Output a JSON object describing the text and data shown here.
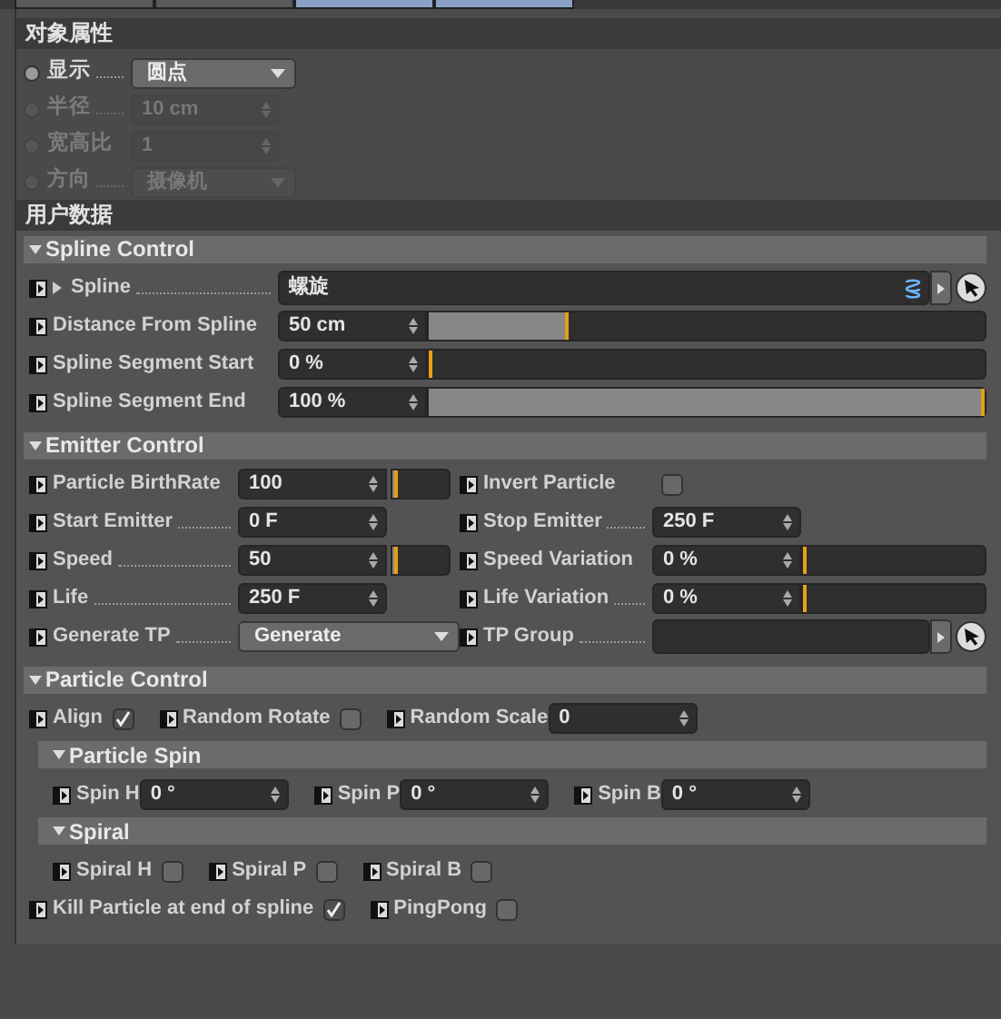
{
  "tabs": [
    {
      "selected": false
    },
    {
      "selected": false
    },
    {
      "selected": true
    },
    {
      "selected": true
    }
  ],
  "object_properties": {
    "title": "对象属性",
    "fields": [
      {
        "label": "显示",
        "leader": true,
        "kind": "dropdown",
        "value": "圆点",
        "disabled": false
      },
      {
        "label": "半径",
        "leader": true,
        "kind": "number",
        "value": "10 cm",
        "disabled": true
      },
      {
        "label": "宽高比",
        "leader": false,
        "kind": "number",
        "value": "1",
        "disabled": true
      },
      {
        "label": "方向",
        "leader": true,
        "kind": "dropdown",
        "value": "摄像机",
        "disabled": true
      }
    ]
  },
  "user_data": {
    "title": "用户数据",
    "groups": [
      {
        "title": "Spline Control",
        "kind": "form",
        "expanded": true,
        "rows": [
          {
            "kind": "row",
            "items": [
              {
                "kind": "link",
                "label": "Spline",
                "leader": true,
                "expandable": true,
                "value": "螺旋"
              }
            ]
          },
          {
            "kind": "row",
            "items": [
              {
                "kind": "slider",
                "label": "Distance From Spline",
                "leader": false,
                "value": "50 cm",
                "level": 0.25
              }
            ]
          },
          {
            "kind": "row",
            "items": [
              {
                "kind": "slider",
                "label": "Spline Segment Start",
                "leader": false,
                "value": "0 %",
                "level": 0
              }
            ]
          },
          {
            "kind": "row",
            "items": [
              {
                "kind": "slider",
                "label": "Spline Segment End",
                "leader": false,
                "value": "100 %",
                "level": 1
              }
            ]
          }
        ]
      },
      {
        "title": "Emitter Control",
        "kind": "grid",
        "expanded": true,
        "rows": [
          {
            "kind": "row",
            "items": [
              {
                "kind": "mini-slider",
                "label": "Particle BirthRate",
                "leader": false,
                "value": "100",
                "level": 0.1
              },
              {
                "kind": "checkbox",
                "label": "Invert Particle",
                "leader": false,
                "checked": false
              }
            ]
          },
          {
            "kind": "row",
            "items": [
              {
                "kind": "number",
                "label": "Start Emitter",
                "leader": true,
                "value": "0 F"
              },
              {
                "kind": "number",
                "label": "Stop Emitter",
                "leader": true,
                "value": "250 F"
              }
            ]
          },
          {
            "kind": "row",
            "items": [
              {
                "kind": "mini-slider",
                "label": "Speed",
                "leader": true,
                "value": "50",
                "level": 0.1
              },
              {
                "kind": "slider",
                "label": "Speed Variation",
                "leader": false,
                "value": "0 %",
                "level": 0
              }
            ]
          },
          {
            "kind": "row",
            "items": [
              {
                "kind": "number",
                "label": "Life",
                "leader": true,
                "value": "250 F"
              },
              {
                "kind": "slider",
                "label": "Life Variation",
                "leader": true,
                "value": "0 %",
                "level": 0
              }
            ]
          },
          {
            "kind": "row",
            "items": [
              {
                "kind": "dropdown",
                "label": "Generate TP",
                "leader": true,
                "value": "Generate"
              },
              {
                "kind": "link",
                "label": "TP Group",
                "leader": true,
                "expandable": false,
                "value": ""
              }
            ]
          }
        ]
      },
      {
        "title": "Particle Control",
        "kind": "inline",
        "expanded": true,
        "rows": [
          {
            "kind": "row",
            "items": [
              {
                "kind": "checkbox",
                "label": "Align",
                "leader": false,
                "checked": true
              },
              {
                "kind": "checkbox",
                "label": "Random Rotate",
                "leader": false,
                "checked": false
              },
              {
                "kind": "number",
                "label": "Random Scale",
                "leader": false,
                "value": "0"
              }
            ]
          },
          {
            "kind": "subgroup",
            "title": "Particle Spin",
            "expanded": true,
            "rows": [
              {
                "kind": "row",
                "items": [
                  {
                    "kind": "number",
                    "label": "Spin H",
                    "leader": false,
                    "value": "0 °"
                  },
                  {
                    "kind": "number",
                    "label": "Spin P",
                    "leader": false,
                    "value": "0 °"
                  },
                  {
                    "kind": "number",
                    "label": "Spin B",
                    "leader": false,
                    "value": "0 °"
                  }
                ]
              }
            ]
          },
          {
            "kind": "subgroup",
            "title": "Spiral",
            "expanded": true,
            "rows": [
              {
                "kind": "row",
                "items": [
                  {
                    "kind": "checkbox",
                    "label": "Spiral H",
                    "leader": false,
                    "checked": false
                  },
                  {
                    "kind": "checkbox",
                    "label": "Spiral P",
                    "leader": false,
                    "checked": false
                  },
                  {
                    "kind": "checkbox",
                    "label": "Spiral B",
                    "leader": false,
                    "checked": false
                  }
                ]
              }
            ]
          },
          {
            "kind": "row",
            "items": [
              {
                "kind": "checkbox",
                "label": "Kill Particle at end of spline",
                "leader": false,
                "checked": true
              },
              {
                "kind": "checkbox",
                "label": "PingPong",
                "leader": false,
                "checked": false
              }
            ]
          }
        ]
      }
    ]
  }
}
